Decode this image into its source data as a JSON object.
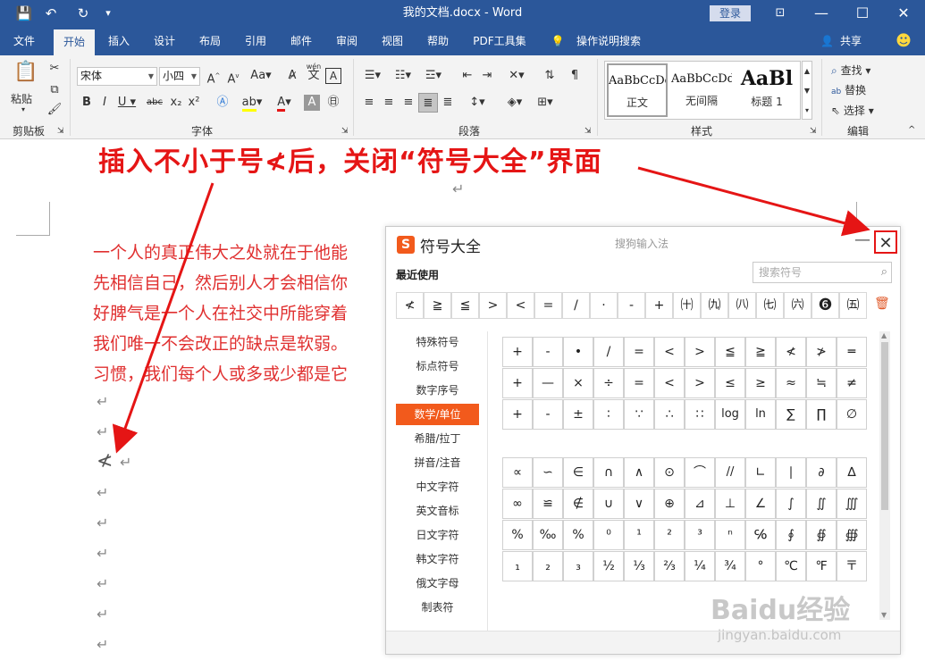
{
  "titlebar": {
    "doc_title": "我的文档.docx - Word",
    "login": "登录",
    "icons": [
      "save-icon",
      "undo-icon",
      "redo-icon",
      "customize-icon"
    ]
  },
  "tabs": [
    {
      "label": "文件"
    },
    {
      "label": "开始"
    },
    {
      "label": "插入"
    },
    {
      "label": "设计"
    },
    {
      "label": "布局"
    },
    {
      "label": "引用"
    },
    {
      "label": "邮件"
    },
    {
      "label": "审阅"
    },
    {
      "label": "视图"
    },
    {
      "label": "帮助"
    },
    {
      "label": "PDF工具集"
    },
    {
      "label": "操作说明搜索"
    }
  ],
  "share_label": "共享",
  "ribbon": {
    "paste_label": "粘贴",
    "clipboard_label": "剪贴板",
    "font_name": "宋体",
    "font_size": "小四",
    "font_label": "字体",
    "paragraph_label": "段落",
    "styles_label": "样式",
    "editing_label": "编辑",
    "find_label": "查找",
    "replace_label": "替换",
    "select_label": "选择",
    "styles": [
      {
        "preview": "AaBbCcDd",
        "name": "正文"
      },
      {
        "preview": "AaBbCcDd",
        "name": "无间隔"
      },
      {
        "preview": "AaBl",
        "name": "标题 1"
      }
    ],
    "wen_label": "wén",
    "wen_char": "文"
  },
  "document": {
    "annotation": "插入不小于号≮后，关闭“符号大全”界面",
    "lines": [
      "一个人的真正伟大之处就在于他能",
      "先相信自己，然后别人才会相信你",
      "好脾气是一个人在社交中所能穿着",
      "我们唯一不会改正的缺点是软弱。",
      "习惯，我们每个人或多或少都是它"
    ],
    "return_mark": "↵",
    "inserted_symbol": "≮"
  },
  "symbol_window": {
    "logo": "S",
    "title": "符号大全",
    "subtitle": "搜狗输入法",
    "minimize": "—",
    "close": "✕",
    "recent_label": "最近使用",
    "search_placeholder": "搜索符号",
    "recent": [
      "≮",
      "≧",
      "≦",
      ">",
      "<",
      "=",
      "/",
      "·",
      "-",
      "+",
      "㈩",
      "㈨",
      "㈧",
      "㈦",
      "㈥",
      "❻",
      "㈤"
    ],
    "categories": [
      {
        "label": "特殊符号"
      },
      {
        "label": "标点符号"
      },
      {
        "label": "数字序号"
      },
      {
        "label": "数学/单位"
      },
      {
        "label": "希腊/拉丁"
      },
      {
        "label": "拼音/注音"
      },
      {
        "label": "中文字符"
      },
      {
        "label": "英文音标"
      },
      {
        "label": "日文字符"
      },
      {
        "label": "韩文字符"
      },
      {
        "label": "俄文字母"
      },
      {
        "label": "制表符"
      }
    ],
    "grid1": [
      [
        "+",
        "-",
        "•",
        "/",
        "=",
        "<",
        ">",
        "≦",
        "≧",
        "≮",
        "≯",
        "═"
      ],
      [
        "+",
        "—",
        "×",
        "÷",
        "=",
        "<",
        ">",
        "≤",
        "≥",
        "≈",
        "≒",
        "≠"
      ],
      [
        "+",
        "-",
        "±",
        "∶",
        "∵",
        "∴",
        "∷",
        "log",
        "ln",
        "∑",
        "∏",
        "∅"
      ]
    ],
    "grid2": [
      [
        "∝",
        "∽",
        "∈",
        "∩",
        "∧",
        "⊙",
        "⌒",
        "//",
        "∟",
        "∣",
        "∂",
        "∆"
      ],
      [
        "∞",
        "≌",
        "∉",
        "∪",
        "∨",
        "⊕",
        "⊿",
        "⊥",
        "∠",
        "∫",
        "∬",
        "∭"
      ],
      [
        "%",
        "‰",
        "%",
        "⁰",
        "¹",
        "²",
        "³",
        "ⁿ",
        "℅",
        "∮",
        "∯",
        "∰"
      ],
      [
        "₁",
        "₂",
        "₃",
        "½",
        "⅓",
        "⅔",
        "¼",
        "¾",
        "°",
        "℃",
        "℉",
        "〒"
      ]
    ]
  },
  "watermark": {
    "text": "Baidu经验",
    "url": "jingyan.baidu.com"
  }
}
